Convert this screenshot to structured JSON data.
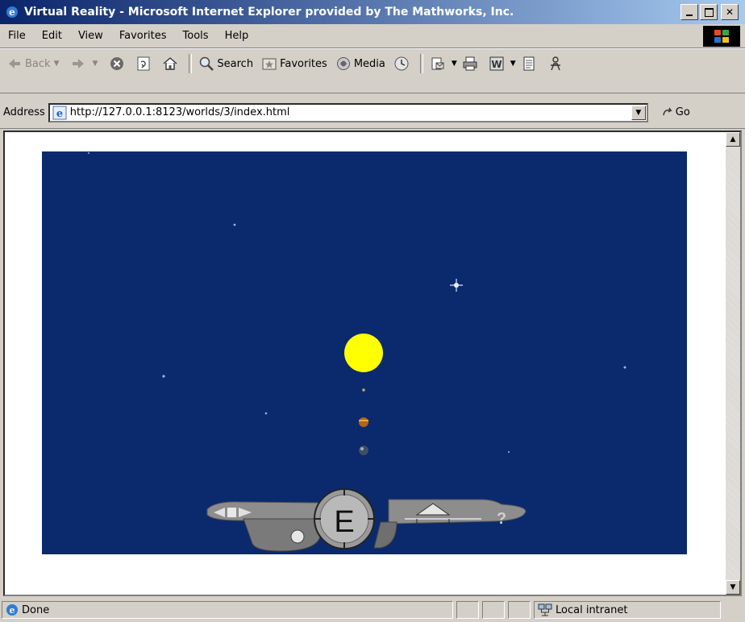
{
  "window": {
    "title": "Virtual Reality - Microsoft Internet Explorer provided by The Mathworks, Inc.",
    "controls": [
      "minimize",
      "maximize",
      "close"
    ]
  },
  "menu": {
    "items": [
      "File",
      "Edit",
      "View",
      "Favorites",
      "Tools",
      "Help"
    ]
  },
  "toolbar": {
    "back_label": "Back",
    "search_label": "Search",
    "favorites_label": "Favorites",
    "media_label": "Media"
  },
  "address": {
    "label": "Address",
    "url": "http://127.0.0.1:8123/worlds/3/index.html",
    "go_label": "Go"
  },
  "vr": {
    "background_color": "#0b2a6e",
    "sun_color": "#ffff00",
    "nav_mode_letter": "E",
    "help_glyph": "?"
  },
  "status": {
    "text": "Done",
    "zone": "Local intranet"
  }
}
